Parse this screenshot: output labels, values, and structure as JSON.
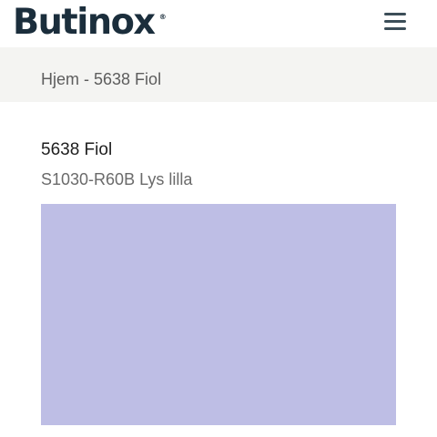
{
  "header": {
    "logo_text": "Butinox",
    "logo_registered": "®",
    "menu_icon": "hamburger-menu-icon"
  },
  "breadcrumb": {
    "home_label": "Hjem",
    "separator": " - ",
    "current_label": "5638 Fiol"
  },
  "product": {
    "title": "5638 Fiol",
    "code_name": "S1030-R60B Lys lilla",
    "swatch_color": "#bebee5"
  },
  "colors": {
    "brand_text": "#1b2e3c",
    "breadcrumb_bg": "#f4f4f2"
  }
}
